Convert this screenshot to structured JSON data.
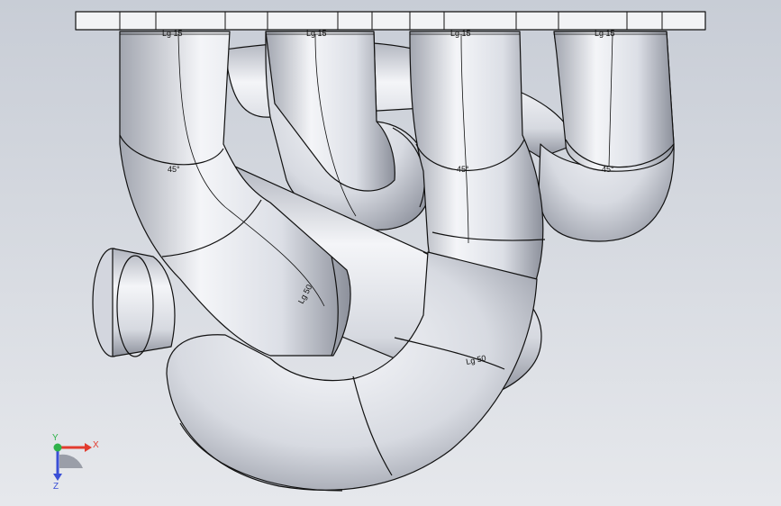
{
  "colors": {
    "background_top": "#c8cdd6",
    "background_bottom": "#e6e8ec",
    "pipe_light": "#f4f5f8",
    "pipe_mid": "#d3d6de",
    "pipe_dark": "#8c909b",
    "outline": "#111111",
    "axis_x": "#e23b2e",
    "axis_y": "#2fb24a",
    "axis_z": "#3a4fd6"
  },
  "annotations": {
    "flange_lg_1": "Lg 15",
    "flange_lg_2": "Lg 15",
    "flange_lg_3": "Lg 15",
    "flange_lg_4": "Lg 15",
    "angle_1": "45°",
    "angle_2": "45°",
    "angle_3": "45°",
    "pipe_lg_1": "Lg 50",
    "pipe_lg_2": "Lg 50"
  },
  "triad": {
    "x_label": "X",
    "y_label": "Y",
    "z_label": "Z",
    "x_icon": "arrow-x-icon",
    "y_icon": "arrow-y-icon",
    "z_icon": "arrow-z-icon"
  }
}
